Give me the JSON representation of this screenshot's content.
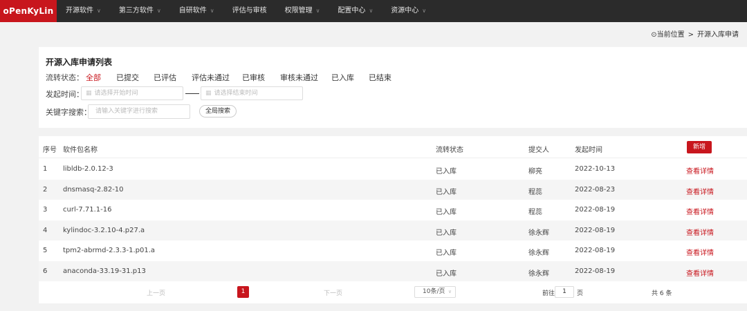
{
  "brand": "oPenKyLin",
  "nav": [
    {
      "label": "开源软件",
      "has_menu": true
    },
    {
      "label": "第三方软件",
      "has_menu": true
    },
    {
      "label": "自研软件",
      "has_menu": true
    },
    {
      "label": "评估与审核",
      "has_menu": false
    },
    {
      "label": "权限管理",
      "has_menu": true
    },
    {
      "label": "配置中心",
      "has_menu": true
    },
    {
      "label": "资源中心",
      "has_menu": true
    }
  ],
  "breadcrumb": {
    "current_label": "当前位置",
    "separator": ">",
    "page": "开源入库申请"
  },
  "filter": {
    "title": "开源入库申请列表",
    "status_label": "流转状态：",
    "status_options": [
      "全部",
      "已提交",
      "已评估",
      "评估未通过",
      "已审核",
      "审核未通过",
      "已入库",
      "已结束"
    ],
    "active_status": "全部",
    "time_label": "发起时间：",
    "start_placeholder": "请选择开始时间",
    "end_placeholder": "请选择结束时间",
    "keyword_label": "关键字搜索：",
    "keyword_placeholder": "请输入关键字进行搜索",
    "search_button": "全局搜索"
  },
  "table": {
    "headers": {
      "index": "序号",
      "package": "软件包名称",
      "status": "流转状态",
      "submitter": "提交人",
      "date": "发起时间"
    },
    "new_button": "新增",
    "rows": [
      {
        "index": "1",
        "package": "libldb-2.0.12-3",
        "status": "已入库",
        "submitter": "柳亮",
        "date": "2022-10-13",
        "action": "查看详情"
      },
      {
        "index": "2",
        "package": "dnsmasq-2.82-10",
        "status": "已入库",
        "submitter": "程蕊",
        "date": "2022-08-23",
        "action": "查看详情"
      },
      {
        "index": "3",
        "package": "curl-7.71.1-16",
        "status": "已入库",
        "submitter": "程蕊",
        "date": "2022-08-19",
        "action": "查看详情"
      },
      {
        "index": "4",
        "package": "kylindoc-3.2.10-4.p27.a",
        "status": "已入库",
        "submitter": "徐永辉",
        "date": "2022-08-19",
        "action": "查看详情"
      },
      {
        "index": "5",
        "package": "tpm2-abrmd-2.3.3-1.p01.a",
        "status": "已入库",
        "submitter": "徐永辉",
        "date": "2022-08-19",
        "action": "查看详情"
      },
      {
        "index": "6",
        "package": "anaconda-33.19-31.p13",
        "status": "已入库",
        "submitter": "徐永辉",
        "date": "2022-08-19",
        "action": "查看详情"
      }
    ]
  },
  "pagination": {
    "prev": "上一页",
    "current_page": "1",
    "next": "下一页",
    "page_size": "10条/页",
    "goto_prefix": "前往",
    "goto_value": "1",
    "goto_suffix": "页",
    "total": "共 6 条"
  },
  "colors": {
    "accent": "#c8161d",
    "topbar": "#2b2b2b",
    "background": "#f2f2f2"
  }
}
